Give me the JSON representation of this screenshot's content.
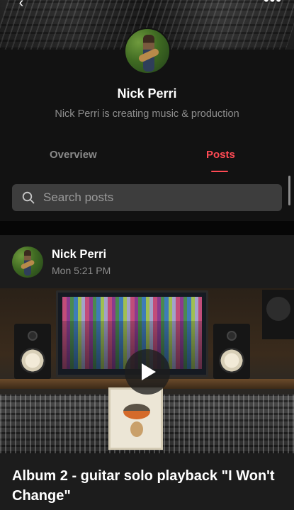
{
  "banner": {
    "back_icon": "chevron-left-icon",
    "more_icon": "more-horizontal-icon"
  },
  "profile": {
    "name": "Nick Perri",
    "tagline": "Nick Perri is creating music & production"
  },
  "tabs": [
    {
      "label": "Overview",
      "active": false
    },
    {
      "label": "Posts",
      "active": true
    }
  ],
  "search": {
    "placeholder": "Search posts",
    "icon": "search-icon"
  },
  "post": {
    "author": "Nick Perri",
    "time": "Mon 5:21 PM",
    "title": "Album 2 - guitar solo playback \"I Won't Change\"",
    "media_icon": "play-icon"
  },
  "colors": {
    "background": "#121212",
    "accent": "#ff4a54",
    "muted_text": "#8d8d8d",
    "search_bg": "#3d3d3d",
    "post_bg": "#1c1c1c"
  }
}
